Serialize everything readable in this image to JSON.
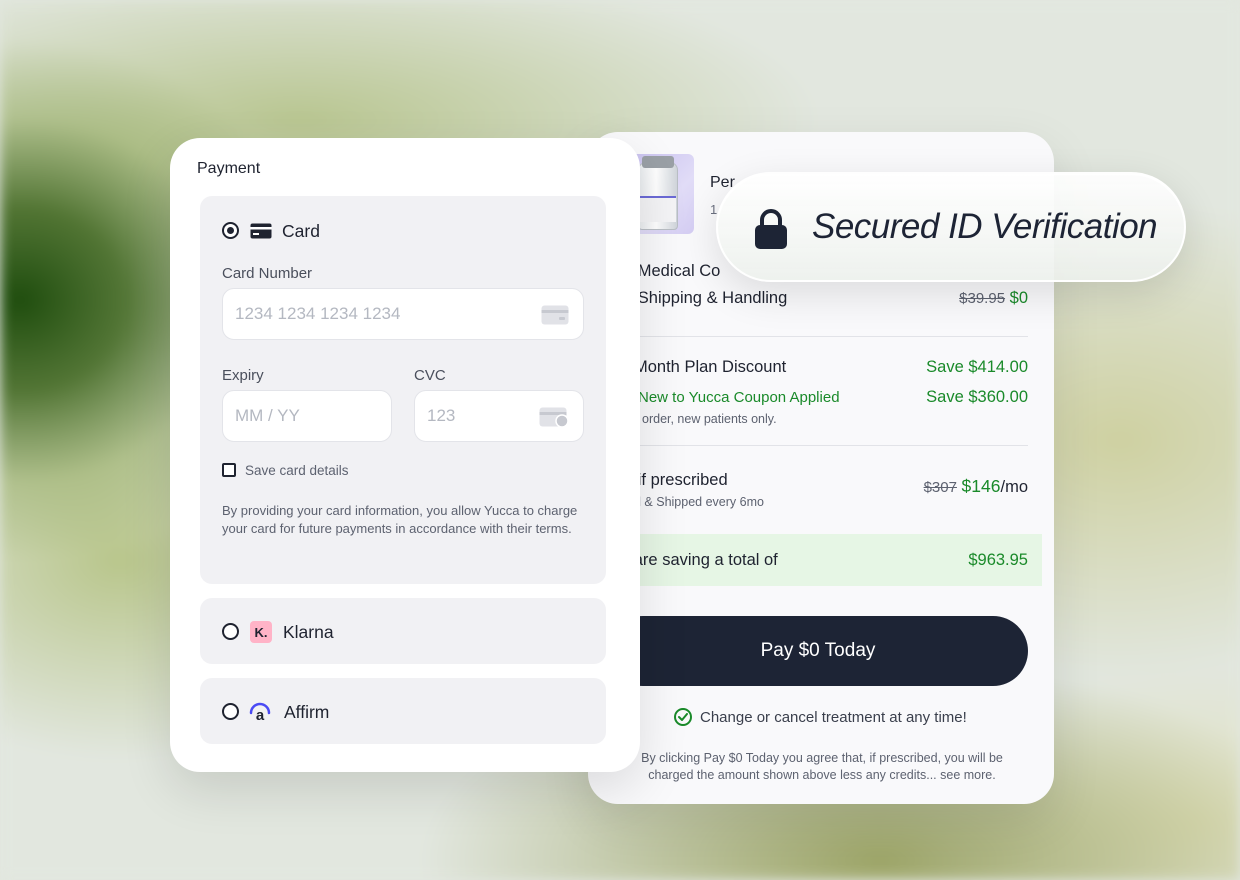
{
  "summary": {
    "product_name": "Per",
    "product_sub": "1",
    "rows": {
      "medical_label": "e Medical Co",
      "shipping_label": "e Shipping & Handling",
      "shipping_old": "$39.95",
      "shipping_new": "$0",
      "plan_discount_label": "Month Plan Discount",
      "plan_discount_value": "Save $414.00",
      "coupon_label": "New to Yucca Coupon Applied",
      "coupon_value": "Save $360.00",
      "coupon_note": "order, new patients only.",
      "prescribed_label": "e if prescribed",
      "prescribed_note": "d & Shipped every 6mo",
      "prescribed_old": "$307",
      "prescribed_new": "$146",
      "prescribed_unit": "/mo"
    },
    "saving_label": "u are saving a total of",
    "saving_value": "$963.95",
    "pay_button": "Pay $0 Today",
    "cancel_text": "Change or cancel treatment at any time!",
    "legal": "By clicking Pay $0 Today you agree that, if prescribed, you will be charged the amount shown above less any credits... see more."
  },
  "badge": {
    "text": "Secured ID Verification",
    "icon": "lock-icon"
  },
  "payment": {
    "title": "Payment",
    "card": {
      "label": "Card",
      "selected": true,
      "card_number_label": "Card Number",
      "card_number_placeholder": "1234 1234 1234 1234",
      "expiry_label": "Expiry",
      "expiry_placeholder": "MM / YY",
      "cvc_label": "CVC",
      "cvc_placeholder": "123",
      "save_label": "Save card details",
      "terms": "By providing your card information, you allow Yucca to charge your card for future payments in accordance with their terms."
    },
    "klarna": {
      "label": "Klarna",
      "logo": "K."
    },
    "affirm": {
      "label": "Affirm",
      "logo": "a"
    }
  },
  "colors": {
    "accent_dark": "#1d2435",
    "savings_green": "#1a8a2a",
    "klarna_pink": "#ffb3c7"
  }
}
